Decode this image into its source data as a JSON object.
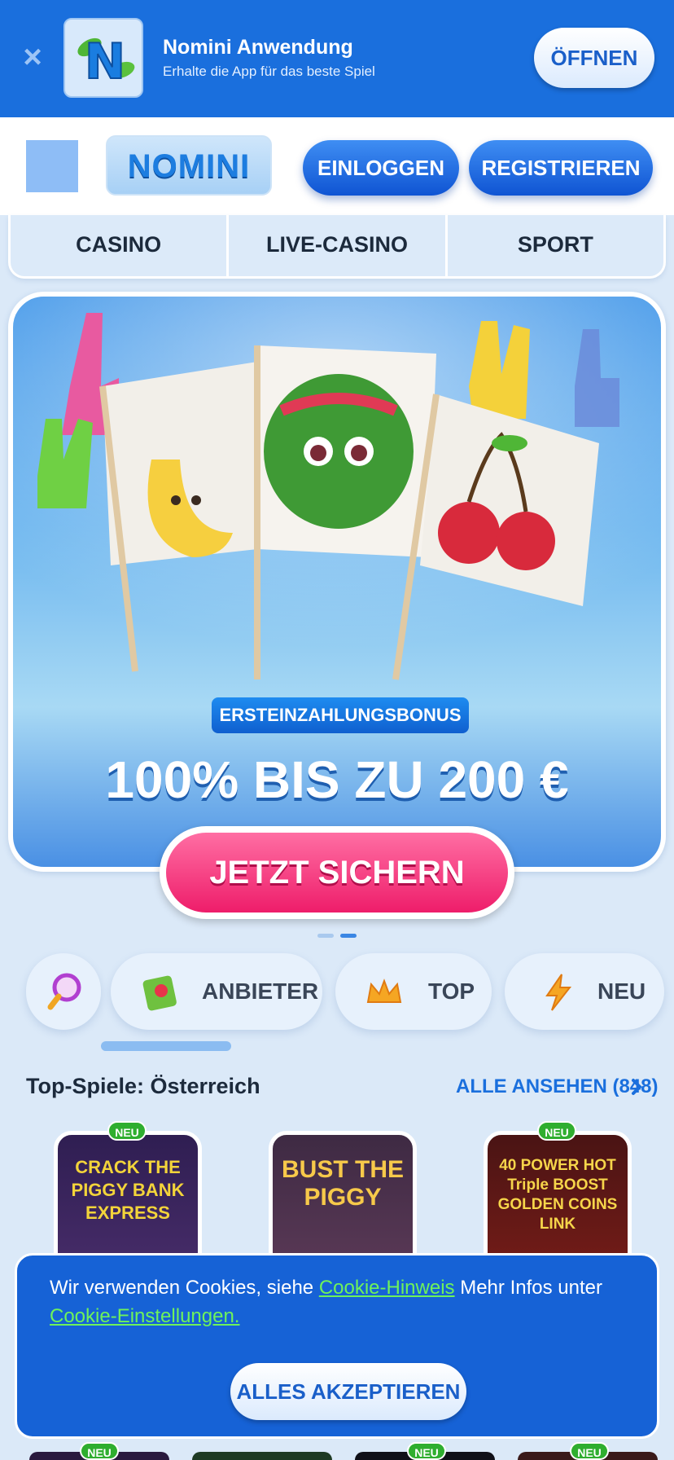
{
  "app_banner": {
    "close_label": "×",
    "app_name": "Nomini Anwendung",
    "app_subtitle": "Erhalte die App für das beste Spiel",
    "open_label": "ÖFFNEN"
  },
  "header": {
    "logo_text": "NOMINI",
    "login_label": "EINLOGGEN",
    "register_label": "REGISTRIEREN"
  },
  "nav": {
    "items": [
      {
        "label": "CASINO"
      },
      {
        "label": "LIVE-CASINO"
      },
      {
        "label": "SPORT"
      }
    ]
  },
  "hero": {
    "tag": "ERSTEINZAHLUNGSBONUS",
    "headline": "100% BIS ZU 200 €",
    "cta_label": "JETZT SICHERN"
  },
  "filters": {
    "provider_label": "ANBIETER",
    "top_label": "TOP",
    "new_label": "NEU"
  },
  "section": {
    "title": "Top-Spiele: Österreich",
    "see_all_label": "ALLE ANSEHEN (848)"
  },
  "games": [
    {
      "title": "CRACK THE PIGGY BANK EXPRESS",
      "badge": "NEU"
    },
    {
      "title": "BUST THE PIGGY",
      "badge": ""
    },
    {
      "title": "40 POWER HOT Triple BOOST GOLDEN COINS LINK",
      "badge": "NEU"
    }
  ],
  "cookie": {
    "text_before": "Wir verwenden Cookies, siehe ",
    "link1": "Cookie-Hinweis",
    "text_middle": " Mehr Infos unter ",
    "link2": "Cookie-Einstellungen.",
    "accept_label": "ALLES AKZEPTIEREN"
  },
  "bottom_badges": [
    "NEU",
    "NEU",
    "NEU"
  ],
  "colors": {
    "primary": "#1a6fdd",
    "background": "#dbe9f8",
    "cta_pink": "#ee1d6a",
    "badge_green": "#2fae2f",
    "link_green": "#6ef25b"
  }
}
